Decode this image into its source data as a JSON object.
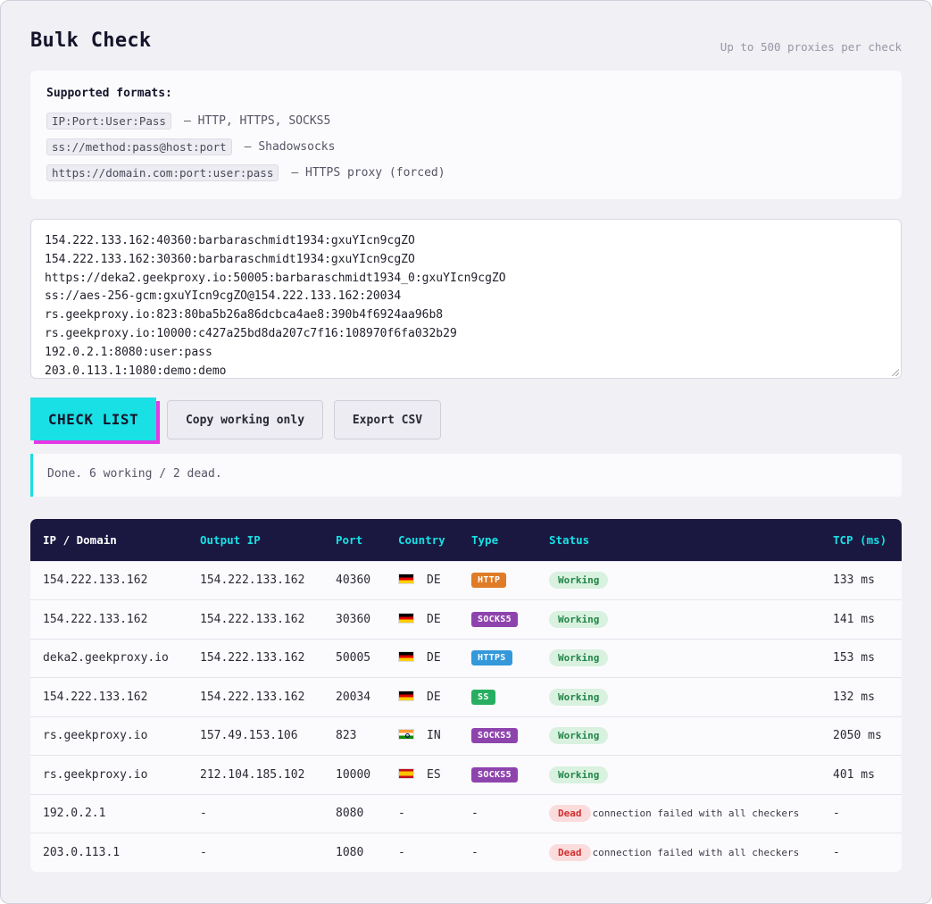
{
  "header": {
    "title": "Bulk Check",
    "subtitle": "Up to 500 proxies per check"
  },
  "formats": {
    "heading": "Supported formats:",
    "items": [
      {
        "code": "IP:Port:User:Pass",
        "desc": "— HTTP, HTTPS, SOCKS5"
      },
      {
        "code": "ss://method:pass@host:port",
        "desc": "— Shadowsocks"
      },
      {
        "code": "https://domain.com:port:user:pass",
        "desc": "— HTTPS proxy (forced)"
      }
    ]
  },
  "input": {
    "lines": [
      "154.222.133.162:40360:barbaraschmidt1934:gxuYIcn9cgZO",
      "154.222.133.162:30360:barbaraschmidt1934:gxuYIcn9cgZO",
      "https://deka2.geekproxy.io:50005:barbaraschmidt1934_0:gxuYIcn9cgZO",
      "ss://aes-256-gcm:gxuYIcn9cgZO@154.222.133.162:20034",
      "rs.geekproxy.io:823:80ba5b26a86dcbca4ae8:390b4f6924aa96b8",
      "rs.geekproxy.io:10000:c427a25bd8da207c7f16:108970f6fa032b29",
      "192.0.2.1:8080:user:pass",
      "203.0.113.1:1080:demo:demo"
    ]
  },
  "actions": {
    "check": "CHECK LIST",
    "copy": "Copy working only",
    "export": "Export CSV"
  },
  "status_message": "Done. 6 working / 2 dead.",
  "colors": {
    "accent": "#18e0e4",
    "accent_shadow": "#e637e6",
    "table_header": "#1a1840",
    "http": "#e07b27",
    "socks5": "#8e44ad",
    "https": "#3498db",
    "ss": "#27ae60"
  },
  "table": {
    "columns": [
      "IP / Domain",
      "Output IP",
      "Port",
      "Country",
      "Type",
      "Status",
      "TCP (ms)"
    ],
    "rows": [
      {
        "ip": "154.222.133.162",
        "out": "154.222.133.162",
        "port": "40360",
        "flag": "de",
        "country": "DE",
        "type": "HTTP",
        "type_color": "#e07b27",
        "status": "Working",
        "reason": "",
        "tcp": "133 ms"
      },
      {
        "ip": "154.222.133.162",
        "out": "154.222.133.162",
        "port": "30360",
        "flag": "de",
        "country": "DE",
        "type": "SOCKS5",
        "type_color": "#8e44ad",
        "status": "Working",
        "reason": "",
        "tcp": "141 ms"
      },
      {
        "ip": "deka2.geekproxy.io",
        "out": "154.222.133.162",
        "port": "50005",
        "flag": "de",
        "country": "DE",
        "type": "HTTPS",
        "type_color": "#3498db",
        "status": "Working",
        "reason": "",
        "tcp": "153 ms"
      },
      {
        "ip": "154.222.133.162",
        "out": "154.222.133.162",
        "port": "20034",
        "flag": "de",
        "country": "DE",
        "type": "SS",
        "type_color": "#27ae60",
        "status": "Working",
        "reason": "",
        "tcp": "132 ms"
      },
      {
        "ip": "rs.geekproxy.io",
        "out": "157.49.153.106",
        "port": "823",
        "flag": "in",
        "country": "IN",
        "type": "SOCKS5",
        "type_color": "#8e44ad",
        "status": "Working",
        "reason": "",
        "tcp": "2050 ms"
      },
      {
        "ip": "rs.geekproxy.io",
        "out": "212.104.185.102",
        "port": "10000",
        "flag": "es",
        "country": "ES",
        "type": "SOCKS5",
        "type_color": "#8e44ad",
        "status": "Working",
        "reason": "",
        "tcp": "401 ms"
      },
      {
        "ip": "192.0.2.1",
        "out": "-",
        "port": "8080",
        "flag": "",
        "country": "-",
        "type": "-",
        "type_color": "",
        "status": "Dead",
        "reason": "connection failed with all checkers",
        "tcp": "-"
      },
      {
        "ip": "203.0.113.1",
        "out": "-",
        "port": "1080",
        "flag": "",
        "country": "-",
        "type": "-",
        "type_color": "",
        "status": "Dead",
        "reason": "connection failed with all checkers",
        "tcp": "-"
      }
    ]
  }
}
